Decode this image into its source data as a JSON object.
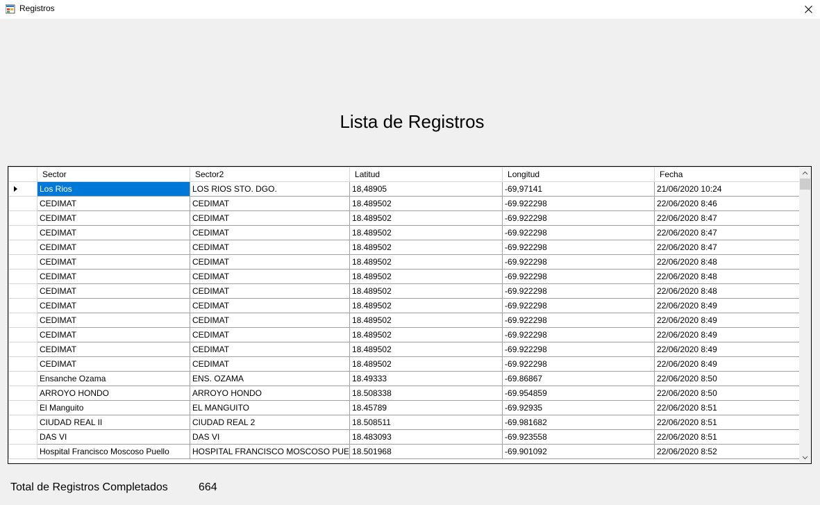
{
  "window": {
    "title": "Registros",
    "icon": "winforms-app-icon",
    "close_icon": "close-icon"
  },
  "heading": "Lista de Registros",
  "grid": {
    "columns": [
      "Sector",
      "Sector2",
      "Latitud",
      "Longitud",
      "Fecha"
    ],
    "selected_row": 0,
    "rows": [
      [
        "Los Rios",
        "LOS RIOS  STO. DGO.",
        "18,48905",
        "-69,97141",
        "21/06/2020 10:24"
      ],
      [
        "CEDIMAT",
        "CEDIMAT",
        "18.489502",
        "-69.922298",
        "22/06/2020 8:46"
      ],
      [
        "CEDIMAT",
        "CEDIMAT",
        "18.489502",
        "-69.922298",
        "22/06/2020 8:47"
      ],
      [
        "CEDIMAT",
        "CEDIMAT",
        "18.489502",
        "-69.922298",
        "22/06/2020 8:47"
      ],
      [
        "CEDIMAT",
        "CEDIMAT",
        "18.489502",
        "-69.922298",
        "22/06/2020 8:47"
      ],
      [
        "CEDIMAT",
        "CEDIMAT",
        "18.489502",
        "-69.922298",
        "22/06/2020 8:48"
      ],
      [
        "CEDIMAT",
        "CEDIMAT",
        "18.489502",
        "-69.922298",
        "22/06/2020 8:48"
      ],
      [
        "CEDIMAT",
        "CEDIMAT",
        "18.489502",
        "-69.922298",
        "22/06/2020 8:48"
      ],
      [
        "CEDIMAT",
        "CEDIMAT",
        "18.489502",
        "-69.922298",
        "22/06/2020 8:49"
      ],
      [
        "CEDIMAT",
        "CEDIMAT",
        "18.489502",
        "-69.922298",
        "22/06/2020 8:49"
      ],
      [
        "CEDIMAT",
        "CEDIMAT",
        "18.489502",
        "-69.922298",
        "22/06/2020 8:49"
      ],
      [
        "CEDIMAT",
        "CEDIMAT",
        "18.489502",
        "-69.922298",
        "22/06/2020 8:49"
      ],
      [
        "CEDIMAT",
        "CEDIMAT",
        "18.489502",
        "-69.922298",
        "22/06/2020 8:49"
      ],
      [
        "Ensanche Ozama",
        "ENS. OZAMA",
        "18.49333",
        "-69.86867",
        "22/06/2020 8:50"
      ],
      [
        "ARROYO HONDO",
        "ARROYO HONDO",
        "18.508338",
        "-69.954859",
        "22/06/2020 8:50"
      ],
      [
        "El Manguito",
        "EL MANGUITO",
        "18.45789",
        "-69.92935",
        "22/06/2020 8:51"
      ],
      [
        "CIUDAD REAL II",
        "CIUDAD REAL 2",
        "18.508511",
        "-69.981682",
        "22/06/2020 8:51"
      ],
      [
        "DAS VI",
        "DAS VI",
        "18.483093",
        "-69.923558",
        "22/06/2020 8:51"
      ],
      [
        "Hospital Francisco Moscoso Puello",
        "HOSPITAL FRANCISCO MOSCOSO PUE",
        "18.501968",
        "-69.901092",
        "22/06/2020 8:52"
      ]
    ]
  },
  "footer": {
    "total_label": "Total de Registros Completados",
    "total_value": "664"
  },
  "colors": {
    "selection": "#0078d7",
    "window_bg": "#f0f0f0",
    "grid_line": "#a0a0a0"
  }
}
